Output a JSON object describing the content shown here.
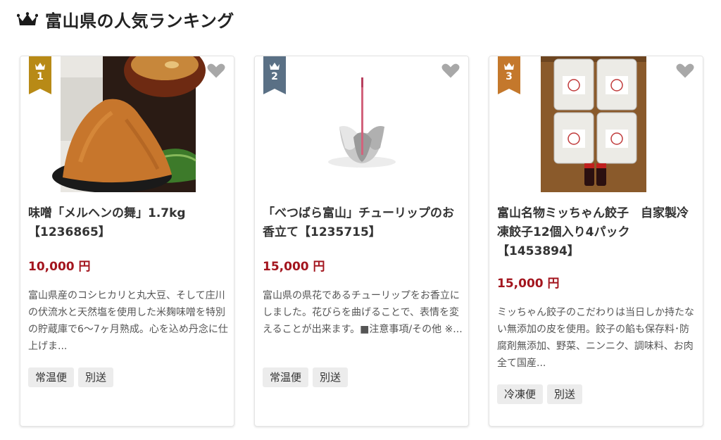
{
  "section": {
    "title": "富山県の人気ランキング",
    "icon": "crown-icon"
  },
  "colors": {
    "rank1": "#b88a16",
    "rank2": "#5a7085",
    "rank3": "#c4782c",
    "price": "#a3151e"
  },
  "cards": [
    {
      "rank": "1",
      "image": "miso-paste-photo",
      "title": "味噌「メルヘンの舞」1.7kg【1236865】",
      "price": "10,000 円",
      "description": "富山県産のコシヒカリと丸大豆、そして庄川の伏流水と天然塩を使用した米麹味噌を特別の貯蔵庫で6〜7ヶ月熟成。心を込め丹念に仕上げま...",
      "tags": [
        "常温便",
        "別送"
      ]
    },
    {
      "rank": "2",
      "image": "tulip-incense-holder-photo",
      "title": "「べつばら富山」チューリップのお香立て【1235715】",
      "price": "15,000 円",
      "description": "富山県の県花であるチューリップをお香立にしました。花びらを曲げることで、表情を変えることが出来ます。■注意事項/その他 ※...",
      "tags": [
        "常温便",
        "別送"
      ]
    },
    {
      "rank": "3",
      "image": "gyoza-packs-photo",
      "title": "富山名物ミッちゃん餃子　自家製冷凍餃子12個入り4パック【1453894】",
      "price": "15,000 円",
      "description": "ミッちゃん餃子のこだわりは当日しか持たない無添加の皮を使用。餃子の餡も保存料･防腐剤無添加、野菜、ニンニク、調味料、お肉全て国産...",
      "tags": [
        "冷凍便",
        "別送"
      ]
    }
  ]
}
